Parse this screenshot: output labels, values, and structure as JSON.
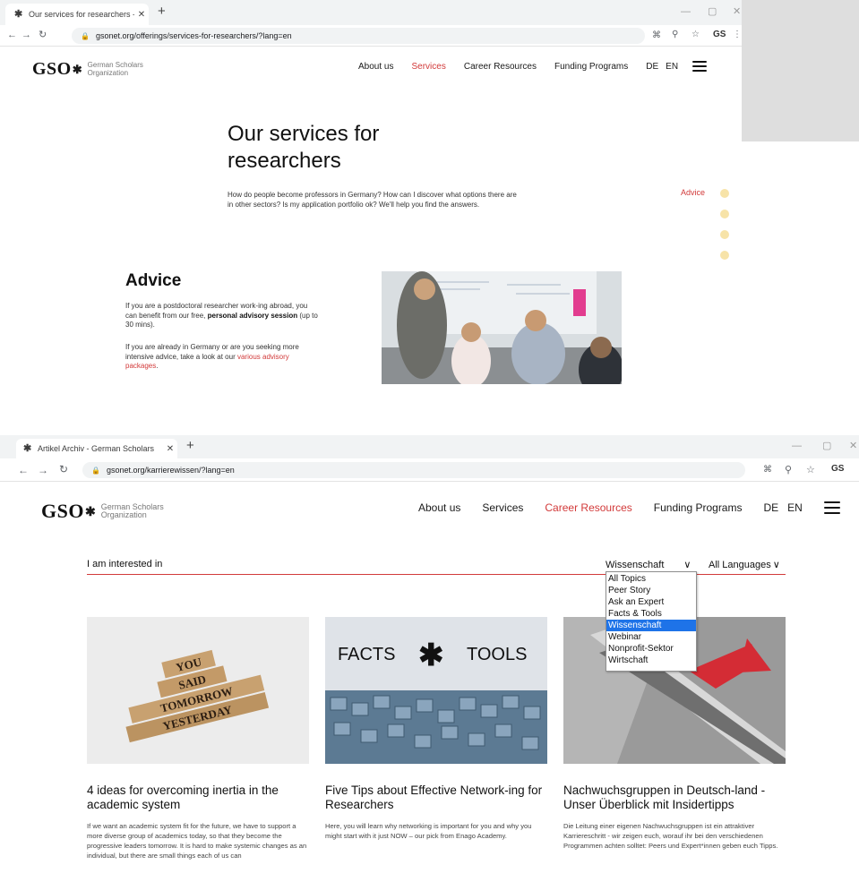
{
  "window1": {
    "tab_title": "Our services for researchers - Ge",
    "url": "gsonet.org/offerings/services-for-researchers/?lang=en",
    "logo_mark": "GSO",
    "logo_sub_line1": "German Scholars",
    "logo_sub_line2": "Organization",
    "nav": {
      "about": "About us",
      "services": "Services",
      "career": "Career Resources",
      "funding": "Funding Programs",
      "de": "DE",
      "en": "EN"
    },
    "active_nav": "Services"
  },
  "services_page": {
    "title_line1": "Our services for",
    "title_line2": "researchers",
    "intro": "How do people become professors in Germany? How can I discover what options there are in other sectors? Is my application portfolio ok? We'll help you find the answers.",
    "side_label": "Advice",
    "advice_heading": "Advice",
    "advice_p1_a": "If you are a postdoctoral researcher work-ing abroad, you can benefit from our free,",
    "advice_p1_bold": "personal advisory session",
    "advice_p1_b": "(up to 30 mins).",
    "advice_p2_a": "If you are already in Germany or are you seeking more intensive advice, take a look at our",
    "advice_p2_link": "various advisory packages",
    "advice_p2_b": "."
  },
  "window2": {
    "tab_title": "Artikel Archiv - German Scholars",
    "url": "gsonet.org/karrierewissen/?lang=en",
    "logo_mark": "GSO",
    "logo_sub_line1": "German Scholars",
    "logo_sub_line2": "Organization",
    "nav": {
      "about": "About us",
      "services": "Services",
      "career": "Career Resources",
      "funding": "Funding Programs",
      "de": "DE",
      "en": "EN"
    },
    "active_nav": "Career Resources"
  },
  "archive": {
    "filter_label": "I am interested in",
    "topic_selected": "Wissenschaft",
    "language_selected": "All Languages",
    "topic_options": [
      "All Topics",
      "Peer Story",
      "Ask an Expert",
      "Facts & Tools",
      "Wissenschaft",
      "Webinar",
      "Nonprofit-Sektor",
      "Wirtschaft"
    ],
    "cards": [
      {
        "title": "4 ideas for overcoming inertia in the academic system",
        "text": "If we want an academic system fit for the future, we have to support a more diverse group of academics today, so that they become the progressive leaders tomorrow. It is hard to make systemic changes as an individual, but there are small things each of us can",
        "img_words": [
          "YOU",
          "SAID",
          "TOMORROW",
          "YESTERDAY"
        ]
      },
      {
        "title": "Five Tips about Effective Network-ing for Researchers",
        "text": "Here, you will learn why networking is important for you and why you might start with it just NOW – our pick from Enago Academy.",
        "img_left": "FACTS",
        "img_right": "TOOLS"
      },
      {
        "title": "Nachwuchsgruppen in Deutsch-land - Unser Überblick mit Insidertipps",
        "text": "Die Leitung einer eigenen Nachwuchsgruppen ist ein attraktiver Karriereschritt - wir zeigen euch, worauf ihr bei den verschiedenen Programmen achten solltet: Peers und Expert*innen geben euch Tipps."
      }
    ]
  },
  "colors": {
    "accent": "#d23a3a",
    "dot": "#f7e3a8",
    "select_highlight": "#1e73e8"
  }
}
